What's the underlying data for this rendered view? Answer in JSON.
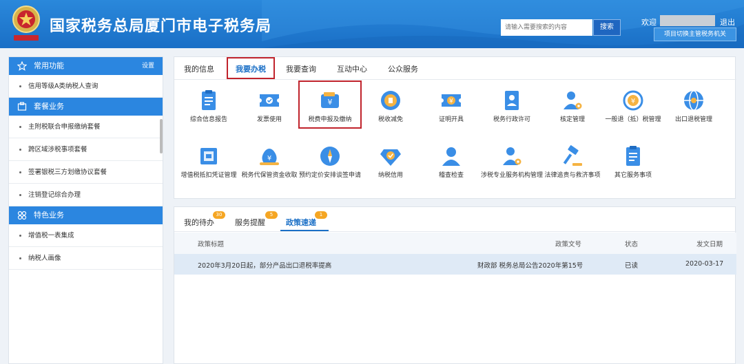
{
  "header": {
    "site_title": "国家税务总局厦门市电子税务局",
    "search_placeholder": "请输入需要搜索的内容",
    "search_label": "搜索",
    "welcome": "欢迎",
    "logout": "退出",
    "switch_label": "项目切换主管税务机关",
    "brand_color": "#1a6fc6"
  },
  "sidebar": {
    "common_title": "常用功能",
    "common_setting": "设置",
    "common_items": [
      "信用等级A类纳税人查询"
    ],
    "package_title": "套餐业务",
    "package_items": [
      "主附税联合申报缴纳套餐",
      "跨区域涉税事项套餐",
      "签署银税三方划缴协议套餐",
      "注销登记综合办理"
    ],
    "feature_title": "特色业务",
    "feature_items": [
      "增值税一表集成",
      "纳税人画像"
    ]
  },
  "tabs": [
    "我的信息",
    "我要办税",
    "我要查询",
    "互动中心",
    "公众服务"
  ],
  "services_row1": [
    "综合信息报告",
    "发票使用",
    "税费申报及缴纳",
    "税收减免",
    "证明开具",
    "税务行政许可",
    "核定管理",
    "一般退（抵）税管理",
    "出口退税管理"
  ],
  "services_row2": [
    "增值税抵扣凭证管理",
    "税务代保管资金收取",
    "预约定价安排谈签申请",
    "纳税信用",
    "稽查检查",
    "涉税专业服务机构管理",
    "法律追责与救济事项",
    "其它服务事项"
  ],
  "bottom": {
    "tabs": [
      "我的待办",
      "服务提醒",
      "政策速递"
    ],
    "badges": [
      "30",
      "5",
      "1"
    ],
    "columns": [
      "政策标题",
      "政策文号",
      "状态",
      "发文日期"
    ],
    "row": {
      "title": "2020年3月20日起，部分产品出口退税率提高",
      "doc_no": "财政部 税务总局公告2020年第15号",
      "status": "已读",
      "date": "2020-03-17"
    },
    "badge_color": "#f5a623"
  },
  "highlight_color": "#c0222b"
}
